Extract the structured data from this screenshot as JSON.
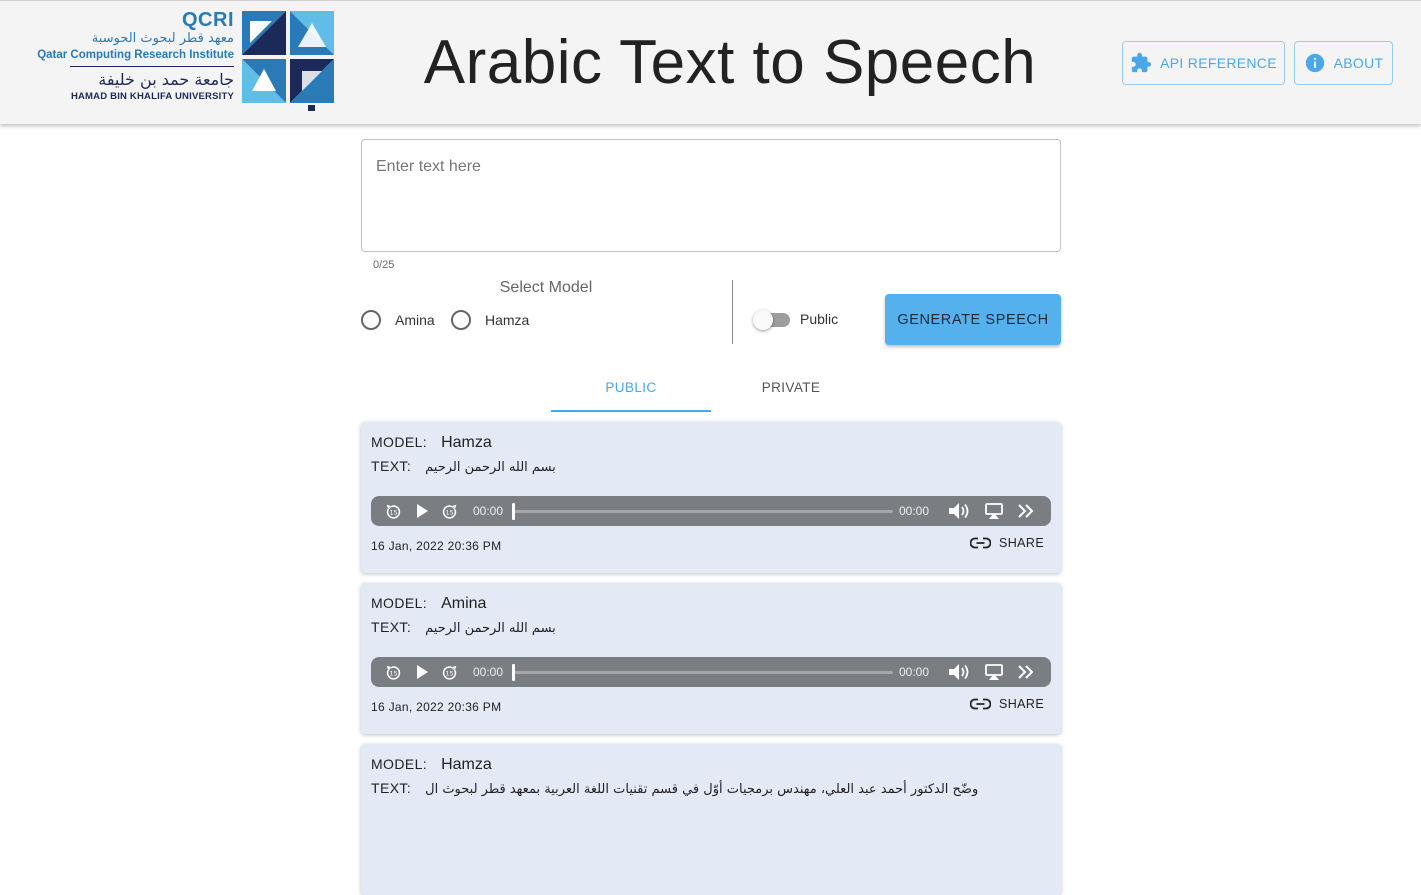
{
  "header": {
    "logo": {
      "acronym": "QCRI",
      "arabic_institute": "معهد قطر لبحوث الحوسبة",
      "english_institute": "Qatar Computing Research Institute",
      "arabic_university": "جامعة حمد بن خليفة",
      "english_university": "HAMAD BIN KHALIFA UNIVERSITY"
    },
    "title": "Arabic Text to Speech",
    "buttons": {
      "api_reference": "API REFERENCE",
      "about": "ABOUT"
    }
  },
  "form": {
    "text_placeholder": "Enter text here",
    "char_counter": "0/25",
    "model_label": "Select Model",
    "models": [
      "Amina",
      "Hamza"
    ],
    "visibility_label": "Public",
    "public_enabled": false,
    "generate_button": "GENERATE SPEECH"
  },
  "tabs": {
    "public": "PUBLIC",
    "private": "PRIVATE",
    "active": "PUBLIC"
  },
  "labels": {
    "model": "MODEL:",
    "text": "TEXT:",
    "share": "SHARE"
  },
  "cards": [
    {
      "model": "Hamza",
      "text": "بسم الله الرحمن الرحيم",
      "time_current": "00:00",
      "time_total": "00:00",
      "date": "16 Jan, 2022 20:36 PM"
    },
    {
      "model": "Amina",
      "text": "بسم الله الرحمن الرحيم",
      "time_current": "00:00",
      "time_total": "00:00",
      "date": "16 Jan, 2022 20:36 PM"
    },
    {
      "model": "Hamza",
      "text": "وضّح الدكتور أحمد عبد العلي، مهندس برمجيات أوّل في قسم تقنيات اللغة العربية بمعهد قطر لبحوث ال"
    }
  ],
  "colors": {
    "accent": "#4aa8ea",
    "generate_button": "#55b1ee",
    "card_background": "#e3eaf6",
    "player_background": "#7a7d82",
    "logo_blue": "#2a7ab8",
    "logo_navy": "#1c2a5a"
  },
  "icons": {
    "api_reference": "puzzle-icon",
    "about": "info-icon",
    "share": "link-icon",
    "player": [
      "skip-back-15-icon",
      "play-icon",
      "skip-forward-15-icon",
      "volume-icon",
      "airplay-icon",
      "playback-speed-icon"
    ]
  }
}
